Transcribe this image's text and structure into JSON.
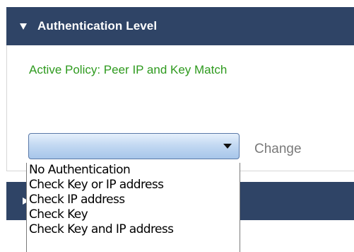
{
  "auth_panel": {
    "title": "Authentication Level",
    "active_policy": "Active Policy: Peer IP and Key Match",
    "change_label": "Change"
  },
  "dropdown": {
    "selected_value": "",
    "options": [
      "No Authentication",
      "Check Key or IP address",
      "Check  IP address",
      "Check Key",
      "Check Key and IP address"
    ]
  },
  "colors": {
    "header_bg": "#2f4466",
    "policy_text": "#2e9a1e",
    "change_text": "#7a7a7a"
  }
}
